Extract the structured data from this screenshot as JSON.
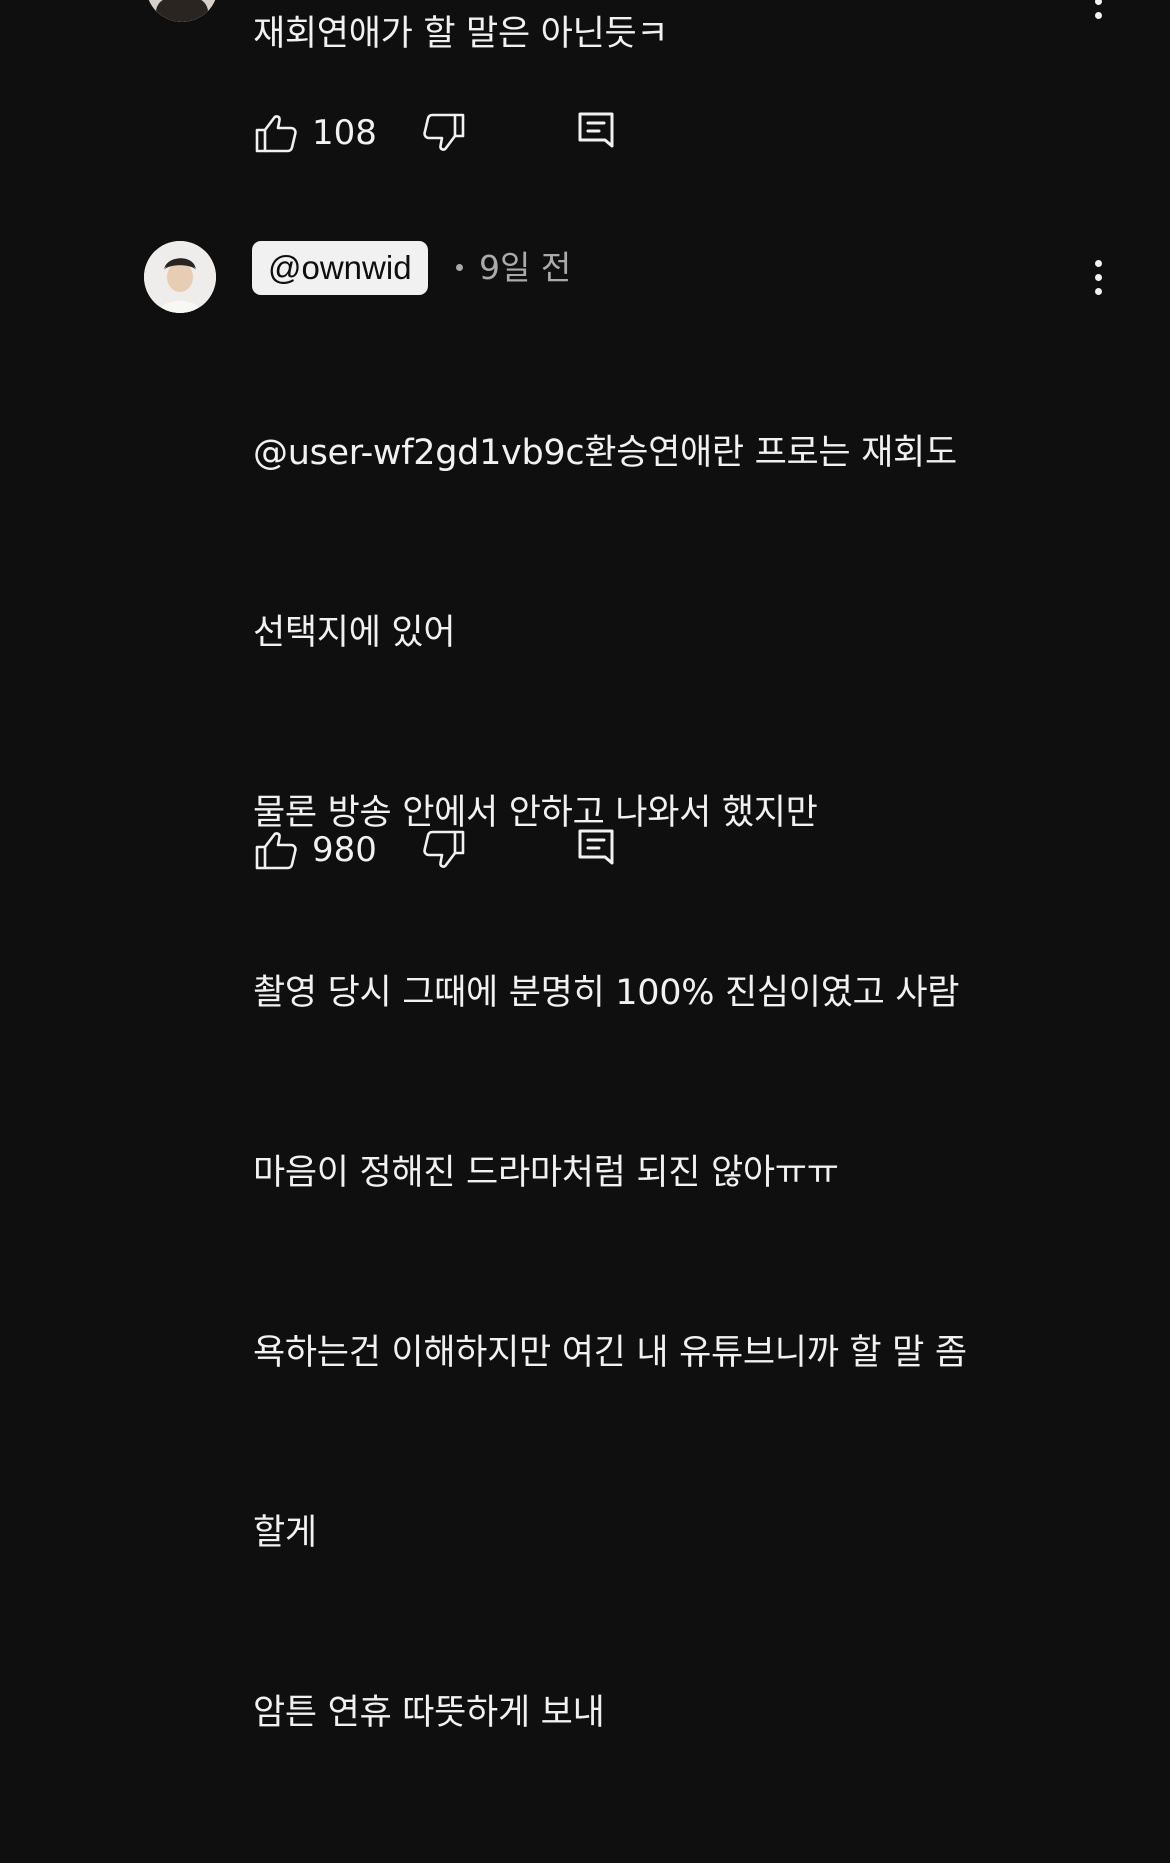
{
  "previous_comment": {
    "text": "재회연애가 할 말은 아닌듯ㅋ",
    "like_count": "108"
  },
  "comment": {
    "handle": "@ownwid",
    "separator": "•",
    "time": "9일 전",
    "lines": [
      "@user-wf2gd1vb9c환승연애란 프로는 재회도",
      "선택지에 있어",
      "물론 방송 안에서 안하고 나와서 했지만",
      "촬영 당시 그때에 분명히 100% 진심이였고 사람",
      "마음이 정해진 드라마처럼 되진 않아ㅠㅠ",
      "욕하는건 이해하지만 여긴 내 유튜브니까 할 말 좀",
      "할게",
      "암튼 연휴 따뜻하게 보내"
    ],
    "like_count": "980"
  },
  "icons": {
    "like": "thumbs-up-icon",
    "dislike": "thumbs-down-icon",
    "reply": "reply-comment-icon",
    "menu": "more-vert-icon"
  },
  "colors": {
    "background": "#0f0f0f",
    "text": "#f1f1f1",
    "secondary_text": "#aaaaaa",
    "handle_chip_bg": "#f1f1f1"
  }
}
